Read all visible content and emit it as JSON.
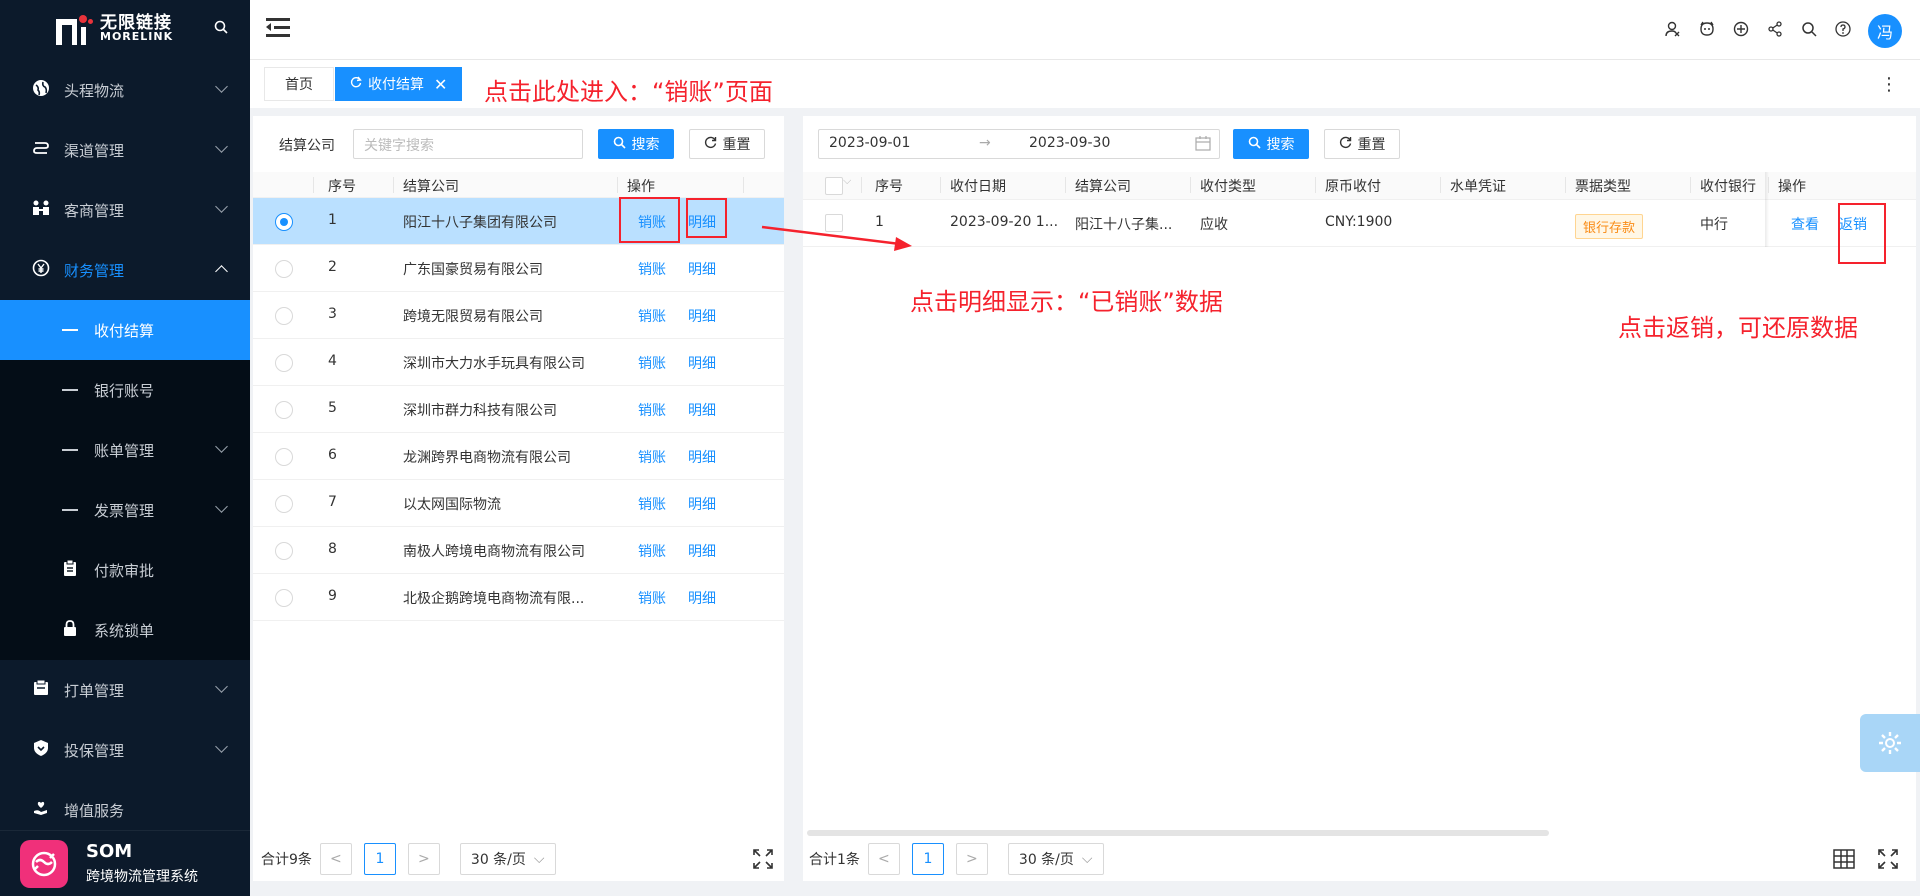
{
  "sidebar": {
    "logo": {
      "cn": "无限链接",
      "en": "MORELINK"
    },
    "search_icon": "search-icon",
    "menu": [
      {
        "label": "头程物流",
        "icon": "globe-icon"
      },
      {
        "label": "渠道管理",
        "icon": "route-icon"
      },
      {
        "label": "客商管理",
        "icon": "people-icon"
      },
      {
        "label": "财务管理",
        "icon": "yen-icon",
        "open": true
      }
    ],
    "submenu": [
      {
        "label": "收付结算",
        "active": true
      },
      {
        "label": "银行账号"
      },
      {
        "label": "账单管理"
      },
      {
        "label": "发票管理"
      },
      {
        "label": "付款审批",
        "icon": "clipboard-icon"
      },
      {
        "label": "系统锁单",
        "icon": "lock-icon"
      }
    ],
    "menu_after": [
      {
        "label": "打单管理",
        "icon": "printer-icon"
      },
      {
        "label": "投保管理",
        "icon": "shield-icon"
      },
      {
        "label": "增值服务",
        "icon": "hand-heart-icon"
      }
    ],
    "footer": {
      "title": "SOM",
      "subtitle": "跨境物流管理系统"
    }
  },
  "topbar": {
    "avatar_text": "冯"
  },
  "tabs": [
    {
      "label": "首页"
    },
    {
      "label": "收付结算",
      "active": true
    }
  ],
  "annotations": {
    "enter": "点击此处进入：“销账”页面",
    "detail": "点击明细显示：“已销账”数据",
    "reverse": "点击返销，可还原数据"
  },
  "left": {
    "filter_label": "结算公司",
    "search_placeholder": "关键字搜索",
    "search_btn": "搜索",
    "reset_btn": "重置",
    "columns": [
      "序号",
      "结算公司",
      "操作"
    ],
    "rows": [
      {
        "no": "1",
        "company": "阳江十八子集团有限公司",
        "selected": true
      },
      {
        "no": "2",
        "company": "广东国豪贸易有限公司"
      },
      {
        "no": "3",
        "company": "跨境无限贸易有限公司"
      },
      {
        "no": "4",
        "company": "深圳市大力水手玩具有限公司"
      },
      {
        "no": "5",
        "company": "深圳市群力科技有限公司"
      },
      {
        "no": "6",
        "company": "龙渊跨界电商物流有限公司"
      },
      {
        "no": "7",
        "company": "以太网国际物流"
      },
      {
        "no": "8",
        "company": "南极人跨境电商物流有限公司"
      },
      {
        "no": "9",
        "company": "北极企鹅跨境电商物流有限..."
      }
    ],
    "action_writeoff": "销账",
    "action_detail": "明细",
    "total": "合计9条",
    "page": "1",
    "page_size": "30 条/页"
  },
  "right": {
    "date_start": "2023-09-01",
    "date_sep": "→",
    "date_end": "2023-09-30",
    "search_btn": "搜索",
    "reset_btn": "重置",
    "columns": [
      "序号",
      "收付日期",
      "结算公司",
      "收付类型",
      "原币收付",
      "水单凭证",
      "票据类型",
      "收付银行",
      "操作"
    ],
    "rows": [
      {
        "no": "1",
        "date": "2023-09-20 1...",
        "company": "阳江十八子集...",
        "type": "应收",
        "amount": "CNY:1900",
        "voucher": "",
        "bill_type": "银行存款",
        "bank": "中行",
        "view": "查看",
        "reverse": "返销"
      }
    ],
    "total": "合计1条",
    "page": "1",
    "page_size": "30 条/页"
  }
}
